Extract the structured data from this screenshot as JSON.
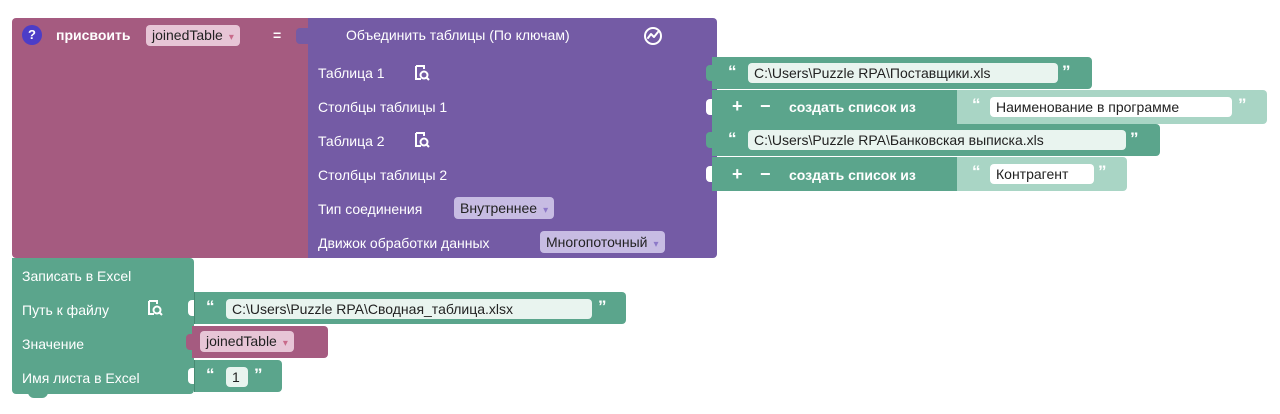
{
  "colors": {
    "variable_block": "#a55b80",
    "variable_dark": "#8c4a6b",
    "join_block": "#745ba5",
    "join_dark": "#5e4a8a",
    "text_block": "#5ba58c",
    "text_light": "#a9d5c5",
    "text_dark": "#478a72",
    "list_block": "#5ba58c"
  },
  "assign": {
    "label": "присвоить",
    "variable": "joinedTable",
    "equals": "="
  },
  "join": {
    "title": "Объединить таблицы (По ключам)",
    "table1_label": "Таблица 1",
    "table1_columns_label": "Столбцы таблицы 1",
    "table2_label": "Таблица 2",
    "table2_columns_label": "Столбцы таблицы 2",
    "join_type_label": "Тип соединения",
    "join_type_value": "Внутреннее",
    "engine_label": "Движок обработки данных",
    "engine_value": "Многопоточный"
  },
  "inputs": {
    "table1_path": "C:\\Users\\Puzzle RPA\\Поставщики.xls",
    "list_label": "создать список из",
    "table1_column": "Наименование в программе",
    "table2_path": "C:\\Users\\Puzzle RPA\\Банковская выписка.xls",
    "table2_column": "Контрагент"
  },
  "excel": {
    "title": "Записать в Excel",
    "path_label": "Путь к файлу",
    "path_value": "C:\\Users\\Puzzle RPA\\Сводная_таблица.xlsx",
    "value_label": "Значение",
    "value_variable": "joinedTable",
    "sheet_label": "Имя листа в Excel",
    "sheet_value": "1"
  },
  "glyphs": {
    "open_quote": "“",
    "close_quote": "”",
    "plus": "+",
    "minus": "−",
    "help": "?",
    "caret": "▾"
  }
}
